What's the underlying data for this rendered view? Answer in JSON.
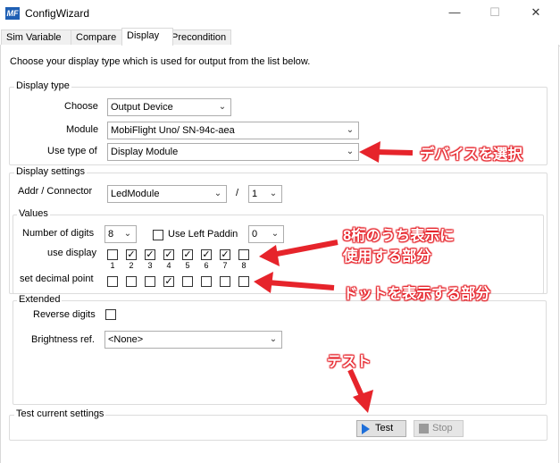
{
  "window": {
    "app_icon": "MF",
    "title": "ConfigWizard",
    "minimize": "—",
    "maximize": "☐",
    "close": "✕"
  },
  "tabs": [
    {
      "label": "Sim Variable"
    },
    {
      "label": "Compare"
    },
    {
      "label": "Display"
    },
    {
      "label": "Precondition"
    }
  ],
  "active_tab": "Display",
  "intro": "Choose your display type which is used for output from the list below.",
  "display_type": {
    "legend": "Display type",
    "choose_label": "Choose",
    "choose_value": "Output Device",
    "module_label": "Module",
    "module_value": "MobiFlight Uno/ SN-94c-aea",
    "use_type_label": "Use type of",
    "use_type_value": "Display Module"
  },
  "display_settings": {
    "legend": "Display settings",
    "addr_label": "Addr / Connector",
    "addr_value": "LedModule",
    "separator": "/",
    "connector_value": "1"
  },
  "values": {
    "legend": "Values",
    "digits_label": "Number of digits",
    "digits_value": "8",
    "left_padding_label": "Use Left Paddin",
    "left_padding_checked": false,
    "padding_value": "0",
    "use_display_label": "use display",
    "use_display": [
      false,
      true,
      true,
      true,
      true,
      true,
      true,
      false
    ],
    "digit_numbers": [
      "1",
      "2",
      "3",
      "4",
      "5",
      "6",
      "7",
      "8"
    ],
    "decimal_label": "set decimal point",
    "decimal_points": [
      false,
      false,
      false,
      true,
      false,
      false,
      false,
      false
    ]
  },
  "extended": {
    "legend": "Extended",
    "reverse_label": "Reverse digits",
    "reverse_checked": false,
    "brightness_label": "Brightness ref.",
    "brightness_value": "<None>"
  },
  "test": {
    "legend": "Test current settings",
    "test_label": "Test",
    "stop_label": "Stop"
  },
  "annotations": {
    "device": "デバイスを選択",
    "digits_line1": "8桁のうち表示に",
    "digits_line2": "使用する部分",
    "dot": "ドットを表示する部分",
    "test": "テスト"
  },
  "colors": {
    "annotation_red": "#e6242b",
    "test_icon_blue": "#1e6fd9"
  }
}
